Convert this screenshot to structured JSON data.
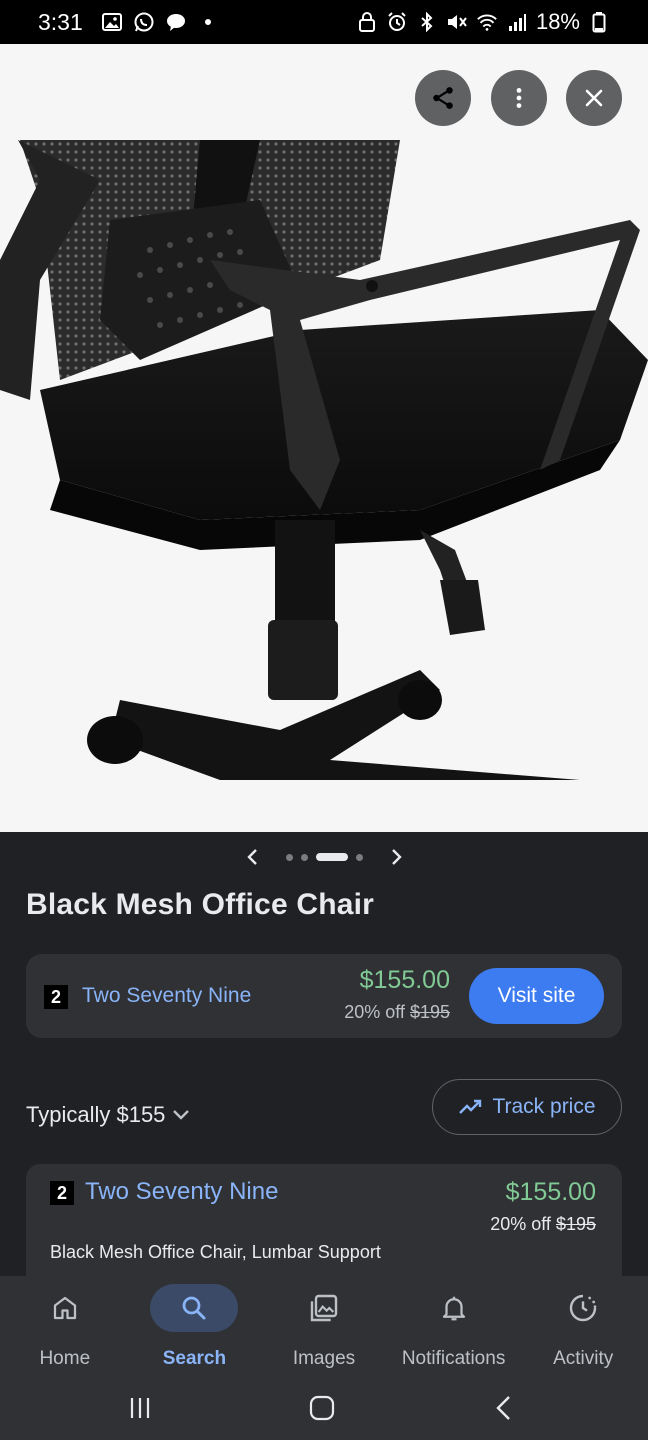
{
  "status_bar": {
    "time": "3:31",
    "battery": "18%"
  },
  "product": {
    "title": "Black Mesh Office Chair"
  },
  "seller_card": {
    "badge": "2",
    "name": "Two Seventy Nine",
    "price": "$155.00",
    "discount_prefix": "20% off",
    "original_price": "$195",
    "visit_label": "Visit site"
  },
  "typical": {
    "label": "Typically $155"
  },
  "track": {
    "label": "Track price"
  },
  "offer_card": {
    "badge": "2",
    "name": "Two Seventy Nine",
    "price": "$155.00",
    "discount_prefix": "20% off",
    "original_price": "$195",
    "description": "Black Mesh Office Chair, Lumbar Support"
  },
  "bottom_nav": {
    "items": [
      {
        "label": "Home",
        "icon": "home-icon"
      },
      {
        "label": "Search",
        "icon": "search-icon",
        "active": true
      },
      {
        "label": "Images",
        "icon": "images-icon"
      },
      {
        "label": "Notifications",
        "icon": "bell-icon"
      },
      {
        "label": "Activity",
        "icon": "activity-icon"
      }
    ]
  },
  "carousel": {
    "dot_count": 4,
    "active_dot": 3
  },
  "colors": {
    "background": "#202124",
    "card": "#303134",
    "link": "#8ab4f8",
    "price": "#81c995",
    "button": "#3c7cf0"
  }
}
